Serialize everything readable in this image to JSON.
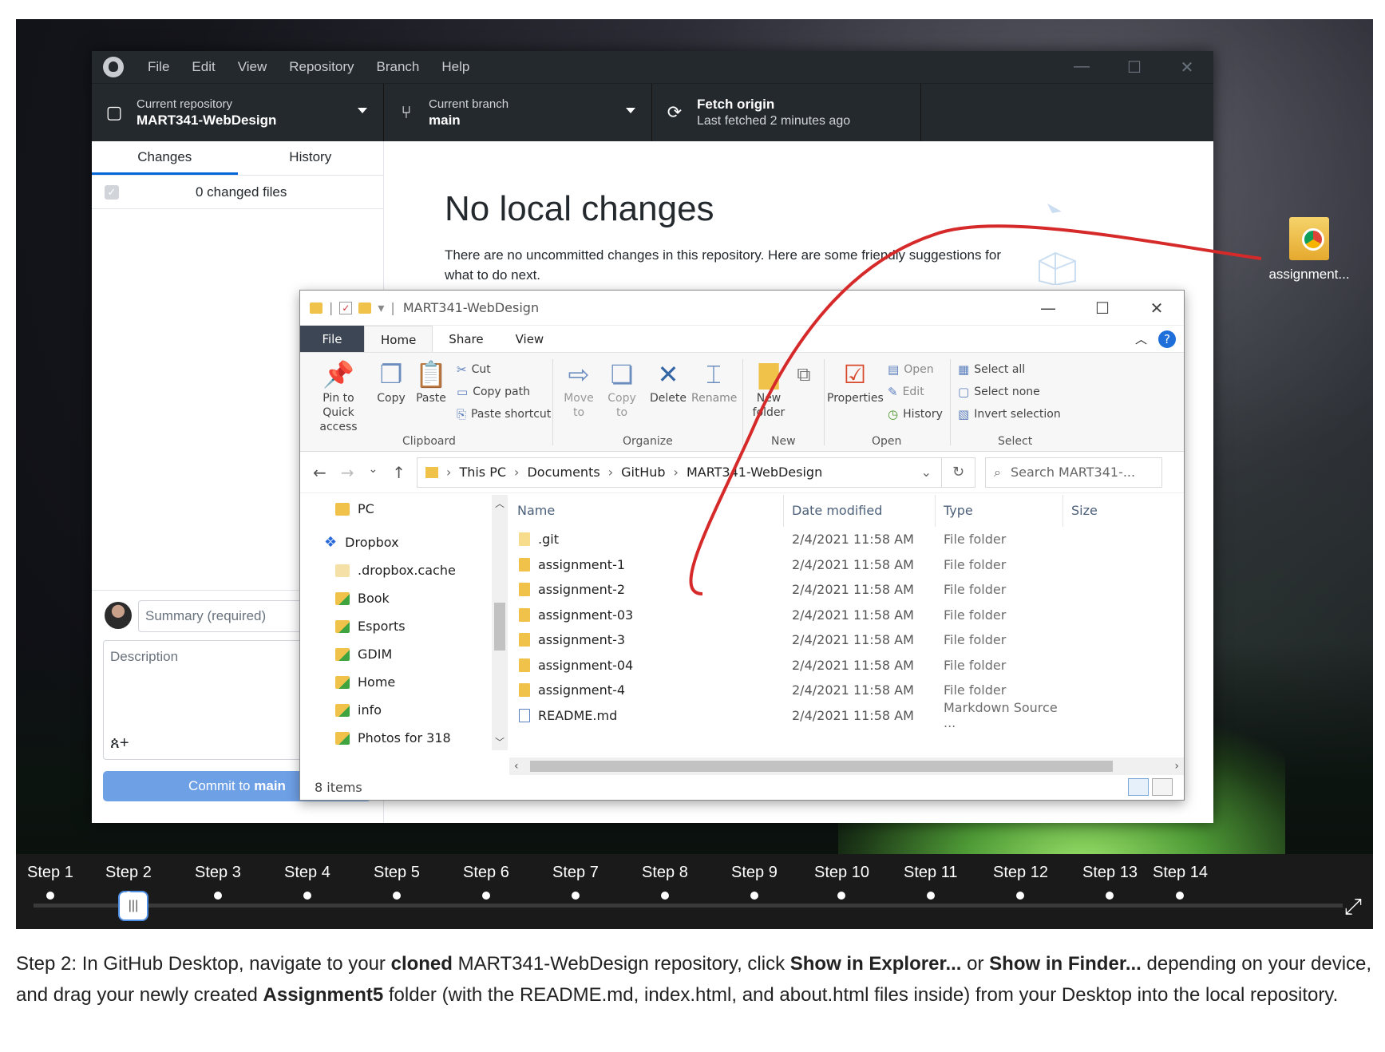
{
  "ghd": {
    "menu": [
      "File",
      "Edit",
      "View",
      "Repository",
      "Branch",
      "Help"
    ],
    "window_controls": [
      "—",
      "☐",
      "✕"
    ],
    "toolbar": {
      "repo_label": "Current repository",
      "repo_value": "MART341-WebDesign",
      "branch_label": "Current branch",
      "branch_value": "main",
      "fetch_title": "Fetch origin",
      "fetch_sub": "Last fetched 2 minutes ago"
    },
    "tabs": [
      "Changes",
      "History"
    ],
    "changed_files": "0 changed files",
    "summary_placeholder": "Summary (required)",
    "description_placeholder": "Description",
    "commit_button_prefix": "Commit to",
    "commit_button_branch": "main",
    "main": {
      "title": "No local changes",
      "text": "There are no uncommitted changes in this repository. Here are some friendly suggestions for what to do next."
    }
  },
  "explorer": {
    "title": "MART341-WebDesign",
    "ribbon_tabs": [
      "File",
      "Home",
      "Share",
      "View"
    ],
    "ribbon": {
      "pin": "Pin to Quick access",
      "copy": "Copy",
      "paste": "Paste",
      "cut": "Cut",
      "copy_path": "Copy path",
      "paste_shortcut": "Paste shortcut",
      "clipboard": "Clipboard",
      "move_to": "Move to",
      "copy_to": "Copy to",
      "delete": "Delete",
      "rename": "Rename",
      "organize": "Organize",
      "new_folder": "New folder",
      "new": "New",
      "properties": "Properties",
      "open": "Open",
      "edit": "Edit",
      "history": "History",
      "open_group": "Open",
      "select_all": "Select all",
      "select_none": "Select none",
      "invert_selection": "Invert selection",
      "select_group": "Select"
    },
    "breadcrumb": [
      "This PC",
      "GitHub",
      "MART341-WebDesign"
    ],
    "breadcrumb_documents": "Documents",
    "search_placeholder": "Search MART341-...",
    "nav": [
      "PC",
      "Dropbox",
      ".dropbox.cache",
      "Book",
      "Esports",
      "GDIM",
      "Home",
      "info",
      "Photos for 318"
    ],
    "columns": [
      "Name",
      "Date modified",
      "Type",
      "Size"
    ],
    "files": [
      {
        "name": ".git",
        "date": "2/4/2021 11:58 AM",
        "type": "File folder"
      },
      {
        "name": "assignment-1",
        "date": "2/4/2021 11:58 AM",
        "type": "File folder"
      },
      {
        "name": "assignment-2",
        "date": "2/4/2021 11:58 AM",
        "type": "File folder"
      },
      {
        "name": "assignment-03",
        "date": "2/4/2021 11:58 AM",
        "type": "File folder"
      },
      {
        "name": "assignment-3",
        "date": "2/4/2021 11:58 AM",
        "type": "File folder"
      },
      {
        "name": "assignment-04",
        "date": "2/4/2021 11:58 AM",
        "type": "File folder"
      },
      {
        "name": "assignment-4",
        "date": "2/4/2021 11:58 AM",
        "type": "File folder"
      },
      {
        "name": "README.md",
        "date": "2/4/2021 11:58 AM",
        "type": "Markdown Source ..."
      }
    ],
    "status": "8 items"
  },
  "desktop_icon_label": "assignment...",
  "steps": [
    "Step 1",
    "Step 2",
    "Step 3",
    "Step 4",
    "Step 5",
    "Step 6",
    "Step 7",
    "Step 8",
    "Step 9",
    "Step 10",
    "Step 11",
    "Step 12",
    "Step 13",
    "Step 14"
  ],
  "current_step": 2,
  "caption": {
    "p1": "Step 2: In GitHub Desktop, navigate to your ",
    "b1": "cloned",
    "p2": " MART341-WebDesign repository, click ",
    "b2": "Show in Explorer...",
    "p3": " or ",
    "b3": "Show in Finder...",
    "p4": " depending on your device, and drag your newly created ",
    "b4": "Assignment5",
    "p5": " folder (with the README.md, index.html, and about.html files inside) from your Desktop into the local repository."
  },
  "colors": {
    "accent": "#0366d6",
    "drag_line": "#d62a2a",
    "commit_button": "#6ea0e6"
  }
}
